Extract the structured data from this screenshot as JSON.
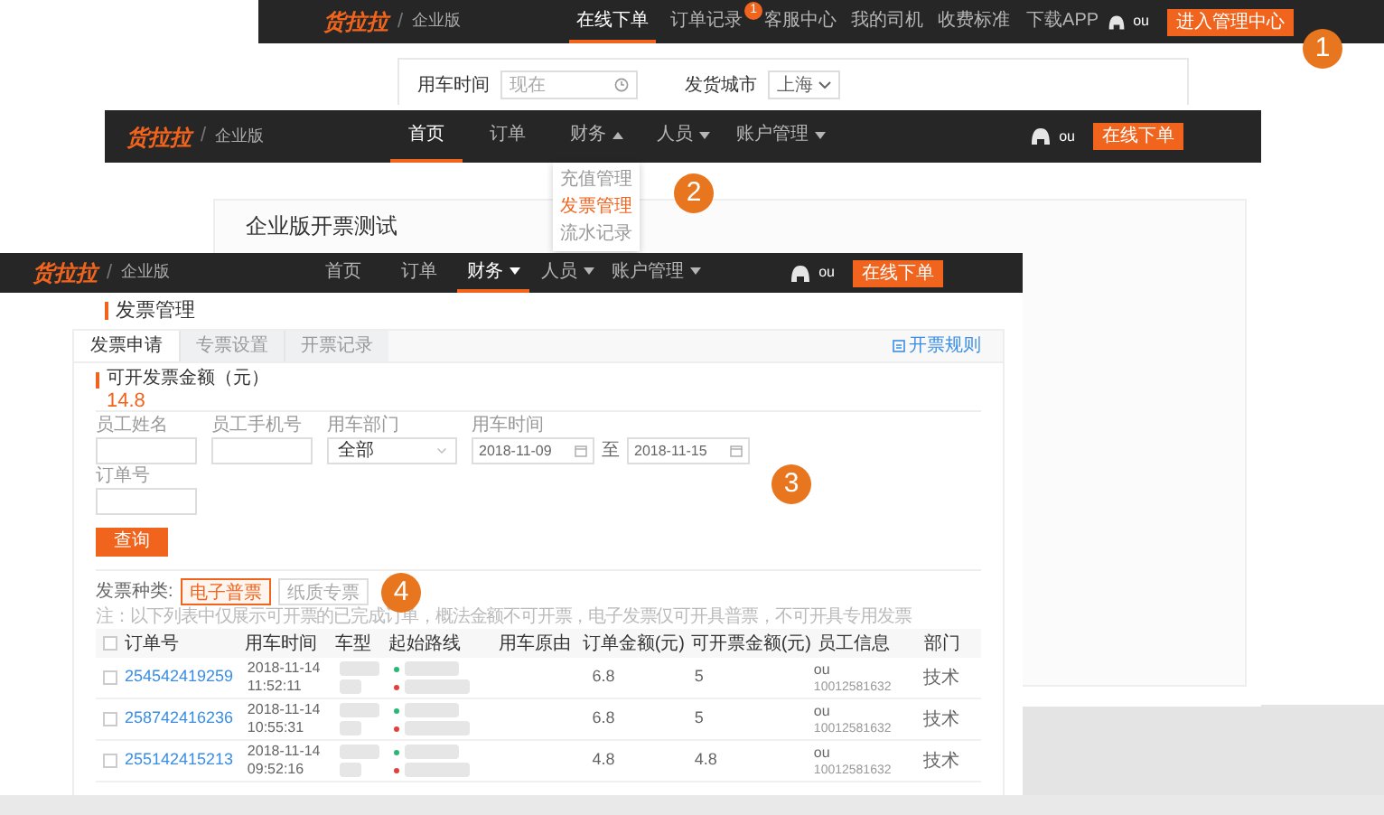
{
  "order_page": {
    "logo": "货拉拉",
    "separator": "/",
    "edition": "企业版",
    "nav": [
      {
        "label": "在线下单",
        "selected": true
      },
      {
        "label": "订单记录",
        "selected": false,
        "badge": "1"
      },
      {
        "label": "客服中心",
        "selected": false
      },
      {
        "label": "我的司机",
        "selected": false
      },
      {
        "label": "收费标准",
        "selected": false
      },
      {
        "label": "下载APP",
        "selected": false
      }
    ],
    "user": "ou",
    "action_button": "进入管理中心",
    "form": {
      "time_label": "用车时间",
      "time_placeholder": "现在",
      "city_label": "发货城市",
      "city_value": "上海"
    }
  },
  "home_page": {
    "logo": "货拉拉",
    "separator": "/",
    "edition": "企业版",
    "nav": [
      {
        "label": "首页",
        "selected": true,
        "has_menu": false
      },
      {
        "label": "订单",
        "selected": false,
        "has_menu": false
      },
      {
        "label": "财务",
        "selected": false,
        "has_menu": true,
        "expanded": true,
        "menu": [
          {
            "label": "充值管理",
            "selected": false
          },
          {
            "label": "发票管理",
            "selected": true
          },
          {
            "label": "流水记录",
            "selected": false
          }
        ]
      },
      {
        "label": "人员",
        "selected": false,
        "has_menu": true,
        "expanded": false
      },
      {
        "label": "账户管理",
        "selected": false,
        "has_menu": true,
        "expanded": false
      }
    ],
    "user": "ou",
    "action_button": "在线下单",
    "card_title": "企业版开票测试"
  },
  "invoice_page": {
    "logo": "货拉拉",
    "separator": "/",
    "edition": "企业版",
    "nav": [
      {
        "label": "首页",
        "selected": false,
        "has_menu": false
      },
      {
        "label": "订单",
        "selected": false,
        "has_menu": false
      },
      {
        "label": "财务",
        "selected": true,
        "has_menu": true,
        "expanded": false
      },
      {
        "label": "人员",
        "selected": false,
        "has_menu": true,
        "expanded": false
      },
      {
        "label": "账户管理",
        "selected": false,
        "has_menu": true,
        "expanded": false
      }
    ],
    "user": "ou",
    "action_button": "在线下单",
    "heading": "发票管理",
    "tabs": [
      {
        "label": "发票申请",
        "selected": true
      },
      {
        "label": "专票设置",
        "selected": false
      },
      {
        "label": "开票记录",
        "selected": false
      }
    ],
    "rules_link": "开票规则",
    "amount_label": "可开发票金额（元）",
    "amount": "14.8",
    "filters": [
      {
        "kind": "text",
        "label": "员工姓名"
      },
      {
        "kind": "text",
        "label": "员工手机号"
      },
      {
        "kind": "select",
        "label": "用车部门",
        "value": "全部"
      },
      {
        "kind": "date_range",
        "label": "用车时间",
        "from": "2018-11-09",
        "separator": "至",
        "to": "2018-11-15"
      },
      {
        "kind": "text",
        "label": "订单号"
      }
    ],
    "query_button": "查询",
    "invoice_type_label": "发票种类:",
    "invoice_types": [
      {
        "label": "电子普票",
        "selected": true
      },
      {
        "label": "纸质专票",
        "selected": false
      }
    ],
    "note": "注：以下列表中仅展示可开票的已完成订单，概法金额不可开票，电子发票仅可开具普票，不可开具专用发票",
    "table": {
      "all_checked": false,
      "columns": [
        "订单号",
        "用车时间",
        "车型",
        "起始路线",
        "用车原由",
        "订单金额(元)",
        "可开票金额(元)",
        "员工信息",
        "部门"
      ],
      "rows": [
        {
          "checked": false,
          "order_no": "254542419259",
          "date": "2018-11-14",
          "time": "11:52:11",
          "order_amount": "6.8",
          "invoice_amount": "5",
          "employee": "ou",
          "phone": "10012581632",
          "department": "技术"
        },
        {
          "checked": false,
          "order_no": "258742416236",
          "date": "2018-11-14",
          "time": "10:55:31",
          "order_amount": "6.8",
          "invoice_amount": "5",
          "employee": "ou",
          "phone": "10012581632",
          "department": "技术"
        },
        {
          "checked": false,
          "order_no": "255142415213",
          "date": "2018-11-14",
          "time": "09:52:16",
          "order_amount": "4.8",
          "invoice_amount": "4.8",
          "employee": "ou",
          "phone": "10012581632",
          "department": "技术"
        }
      ]
    }
  },
  "step_markers": [
    "1",
    "2",
    "3",
    "4"
  ]
}
